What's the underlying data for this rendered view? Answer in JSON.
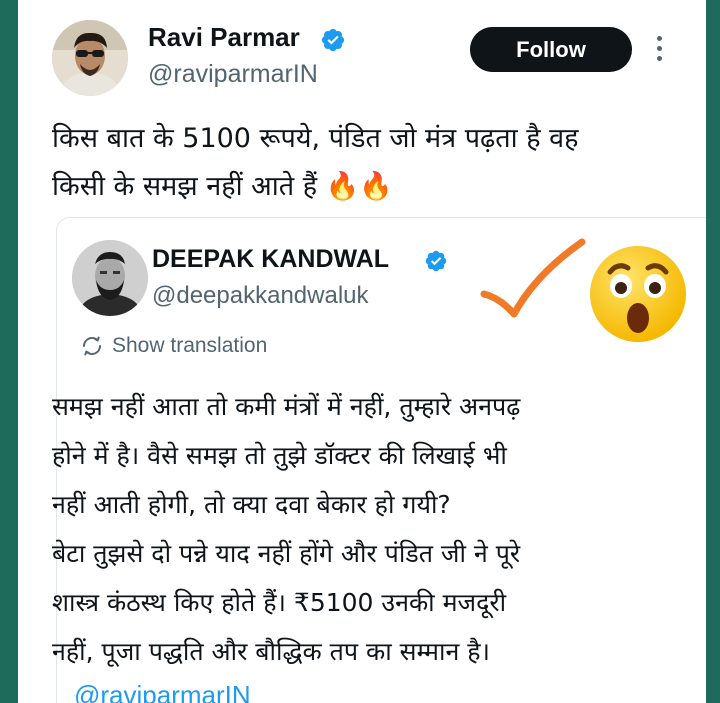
{
  "tweet": {
    "author_name": "Ravi Parmar",
    "author_handle": "@raviparmarIN",
    "follow_label": "Follow",
    "text_lines": [
      "किस बात के 5100 रूपये, पंडित जो मंत्र पढ़ता है वह",
      "किसी के समझ नहीं आते हैं 🔥🔥"
    ]
  },
  "quoted": {
    "author_name": "DEEPAK KANDWAL",
    "author_handle": "@deepakkandwaluk",
    "translation_label": "Show translation",
    "text_lines": [
      "समझ नहीं आता तो कमी मंत्रों में नहीं, तुम्हारे अनपढ़",
      "होने में है। वैसे समझ तो तुझे डॉक्टर की लिखाई भी",
      "नहीं आती होगी, तो क्या दवा बेकार हो गयी?",
      "बेटा तुझसे दो पन्ने याद नहीं होंगे और पंडित जी ने पूरे",
      "शास्त्र कंठस्थ किए होते हैं। ₹5100 उनकी मजदूरी",
      "नहीं, पूजा पद्धति और बौद्धिक तप का सम्मान है।"
    ],
    "mention": "@raviparmarIN"
  },
  "colors": {
    "background": "#1e6b5c",
    "verified": "#1d9bf0",
    "checkmark_overlay": "#f07a28",
    "emoji_face": "#ffc929"
  },
  "icons": [
    "verified-badge-icon",
    "more-options-icon",
    "translate-icon",
    "fire-emoji",
    "checkmark-icon",
    "astonished-face-emoji"
  ]
}
